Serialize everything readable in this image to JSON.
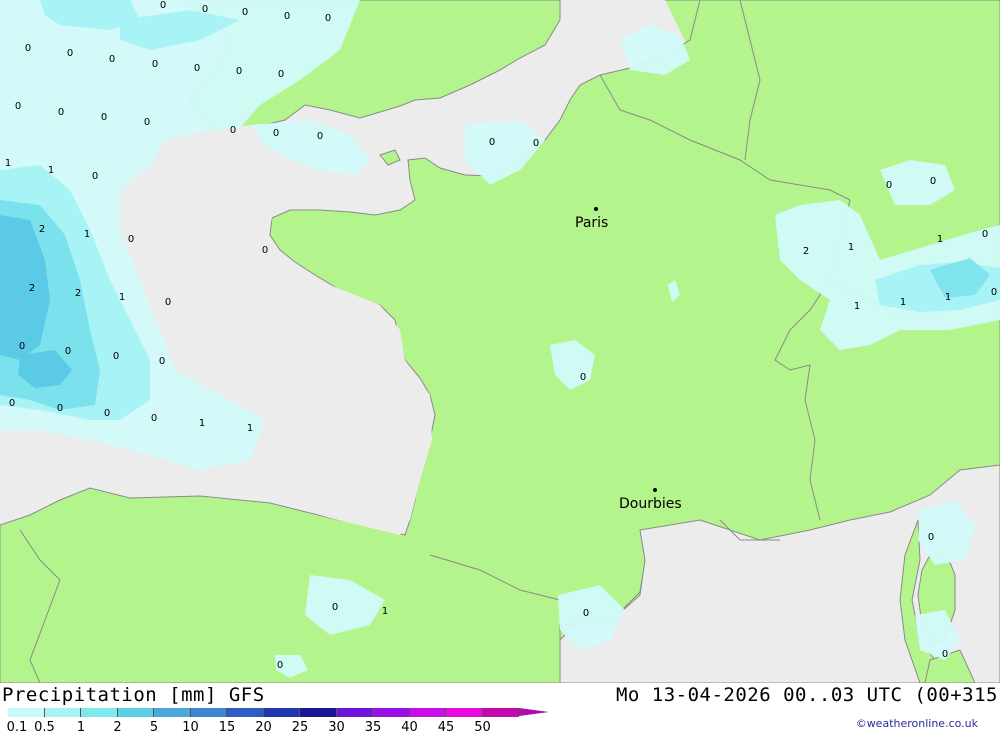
{
  "map": {
    "cities": [
      {
        "name": "Paris"
      },
      {
        "name": "Dourbies"
      }
    ],
    "values": [
      "0",
      "0",
      "0",
      "0",
      "0",
      "0",
      "0",
      "0",
      "0",
      "0",
      "0",
      "0",
      "0",
      "0",
      "0",
      "0",
      "0",
      "0",
      "0",
      "0",
      "0",
      "0",
      "0",
      "1",
      "1",
      "0",
      "2",
      "1",
      "0",
      "2",
      "1",
      "1",
      "0",
      "2",
      "2",
      "1",
      "0",
      "1",
      "1",
      "1",
      "0",
      "0",
      "0",
      "0",
      "0",
      "0",
      "0",
      "0",
      "0",
      "0",
      "1",
      "1",
      "0",
      "0",
      "0",
      "1",
      "0",
      "0",
      "0",
      "0"
    ]
  },
  "footer": {
    "title": "Precipitation [mm] GFS",
    "timestamp": "Mo 13-04-2026 00..03 UTC (00+315",
    "credit": "©weatheronline.co.uk"
  },
  "legend": {
    "ticks": [
      "0.1",
      "0.5",
      "1",
      "2",
      "5",
      "10",
      "15",
      "20",
      "25",
      "30",
      "35",
      "40",
      "45",
      "50"
    ],
    "colors": [
      "#c8fafa",
      "#a6f2f4",
      "#7de9ec",
      "#5ccde4",
      "#4aa8dc",
      "#3c86d2",
      "#2e5cc6",
      "#2236b0",
      "#1a1898",
      "#6c14d8",
      "#9a10e4",
      "#c80ee6",
      "#e60cdc",
      "#c00ab0"
    ]
  },
  "colors": {
    "sea": "#ececec",
    "land": "#b4f48c",
    "border": "#8a8a8a",
    "precip_light": "#d2fafa",
    "precip_mid": "#a4f2f6",
    "precip_high": "#78e0ec",
    "precip_max": "#58c8e4"
  }
}
